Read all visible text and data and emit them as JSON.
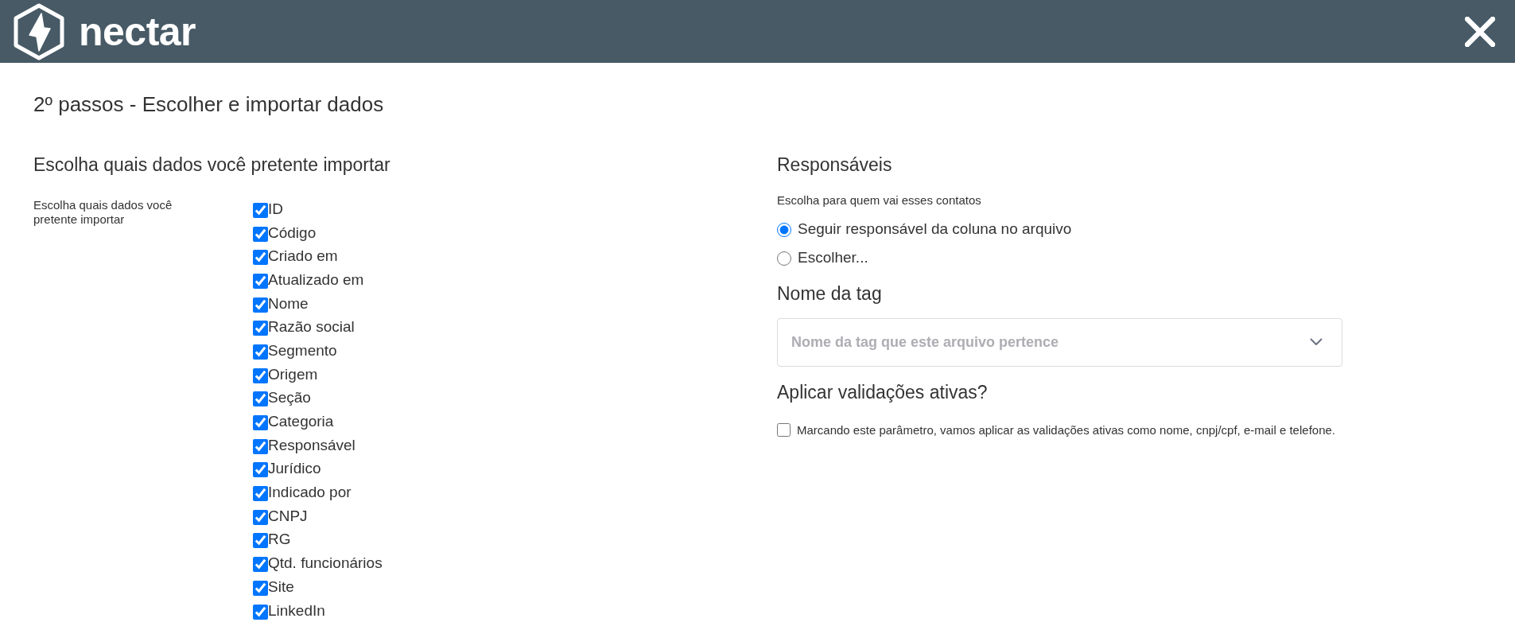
{
  "header": {
    "logo_text": "nectar"
  },
  "page": {
    "title": "2º passos - Escolher e importar dados"
  },
  "fields_section": {
    "heading": "Escolha quais dados você pretente importar",
    "label": "Escolha quais dados você pretente importar",
    "fields": [
      {
        "label": "ID",
        "checked": true
      },
      {
        "label": "Código",
        "checked": true
      },
      {
        "label": "Criado em",
        "checked": true
      },
      {
        "label": "Atualizado em",
        "checked": true
      },
      {
        "label": "Nome",
        "checked": true
      },
      {
        "label": "Razão social",
        "checked": true
      },
      {
        "label": "Segmento",
        "checked": true
      },
      {
        "label": "Origem",
        "checked": true
      },
      {
        "label": "Seção",
        "checked": true
      },
      {
        "label": "Categoria",
        "checked": true
      },
      {
        "label": "Responsável",
        "checked": true
      },
      {
        "label": "Jurídico",
        "checked": true
      },
      {
        "label": "Indicado por",
        "checked": true
      },
      {
        "label": "CNPJ",
        "checked": true
      },
      {
        "label": "RG",
        "checked": true
      },
      {
        "label": "Qtd. funcionários",
        "checked": true
      },
      {
        "label": "Site",
        "checked": true
      },
      {
        "label": "LinkedIn",
        "checked": true
      }
    ]
  },
  "owners_section": {
    "heading": "Responsáveis",
    "prompt": "Escolha para quem vai esses contatos",
    "options": [
      {
        "label": "Seguir responsável da coluna no arquivo",
        "selected": true
      },
      {
        "label": "Escolher...",
        "selected": false
      }
    ]
  },
  "tag_section": {
    "heading": "Nome da tag",
    "select": {
      "placeholder": "Nome da tag que este arquivo pertence"
    }
  },
  "validation_section": {
    "heading": "Aplicar validações ativas?",
    "checkbox": {
      "label": "Marcando este parâmetro, vamos aplicar as validações ativas como nome, cnpj/cpf, e-mail e telefone.",
      "checked": false
    }
  }
}
